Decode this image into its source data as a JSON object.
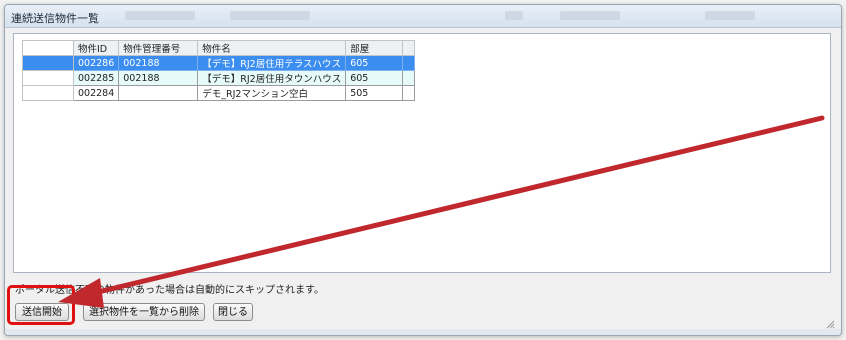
{
  "window": {
    "title": "連続送信物件一覧"
  },
  "table": {
    "headers": [
      "物件ID",
      "物件管理番号",
      "物件名",
      "部屋"
    ],
    "rows": [
      {
        "id": "002286",
        "mgmt": "002188",
        "name": "【デモ】RJ2居住用テラスハウス",
        "room": "605",
        "state": "selected"
      },
      {
        "id": "002285",
        "mgmt": "002188",
        "name": "【デモ】RJ2居住用タウンハウス",
        "room": "605",
        "state": "alt"
      },
      {
        "id": "002284",
        "mgmt": "",
        "name": "デモ_RJ2マンション空白",
        "room": "505",
        "state": "normal"
      }
    ]
  },
  "notice": "ポータル送信不可の物件があった場合は自動的にスキップされます。",
  "buttons": {
    "start": "送信開始",
    "delete": "選択物件を一覧から削除",
    "close": "閉じる"
  },
  "colors": {
    "selection": "#3b8df0",
    "alt_row": "#e6faf7",
    "annotation": "#c0282d"
  },
  "icons": {
    "annotation_arrow": "arrow-icon",
    "resize_grip": "resize-grip-icon"
  }
}
